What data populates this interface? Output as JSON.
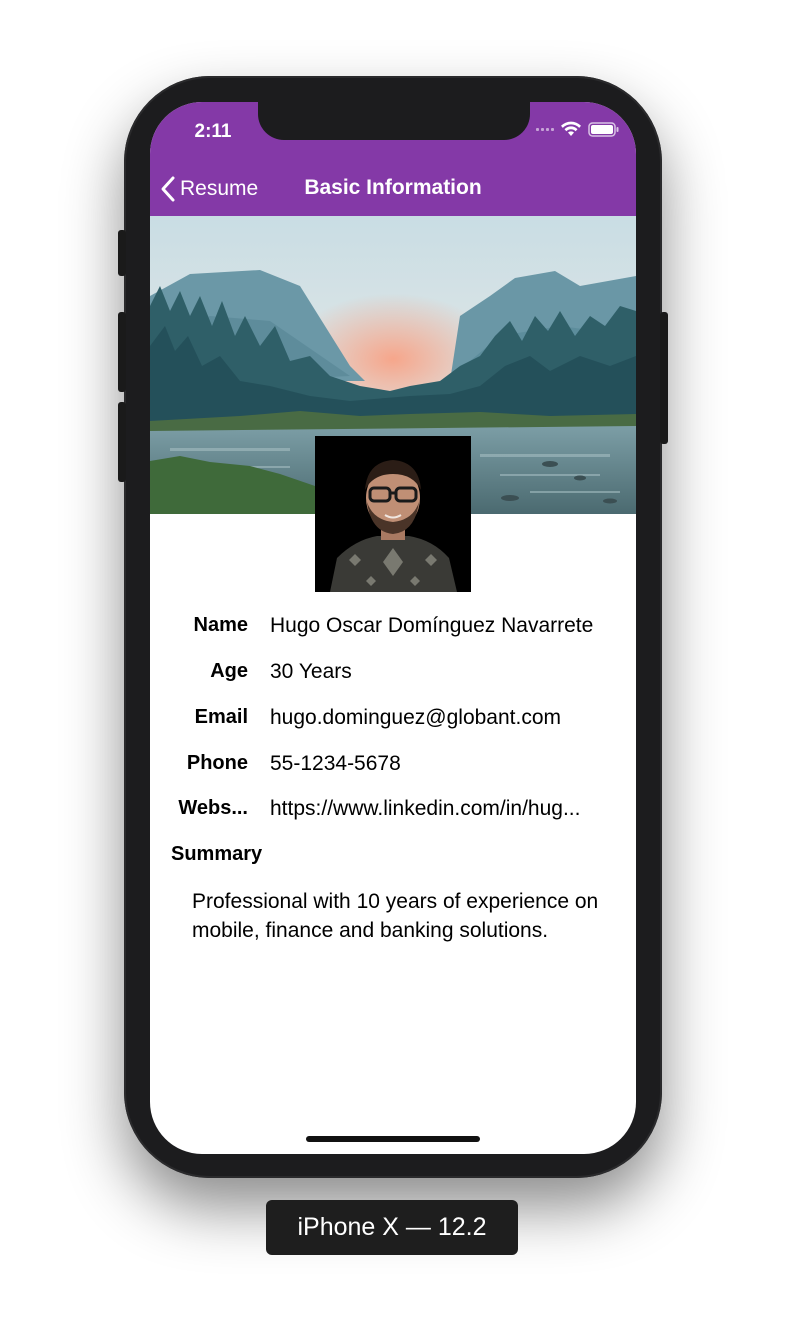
{
  "status_bar": {
    "time": "2:11"
  },
  "nav": {
    "back_label": "Resume",
    "title": "Basic Information"
  },
  "profile": {
    "fields": [
      {
        "label": "Name",
        "value": "Hugo Oscar Domínguez Navarrete"
      },
      {
        "label": "Age",
        "value": "30 Years"
      },
      {
        "label": "Email",
        "value": "hugo.dominguez@globant.com"
      },
      {
        "label": "Phone",
        "value": "55-1234-5678"
      },
      {
        "label": "Webs...",
        "value": "https://www.linkedin.com/in/hug..."
      }
    ],
    "summary_label": "Summary",
    "summary_text": "Professional with 10 years of experience on mobile, finance and banking solutions."
  },
  "device_label": "iPhone X — 12.2",
  "colors": {
    "nav_bar": "#8439a7",
    "frame": "#1c1c1e"
  }
}
